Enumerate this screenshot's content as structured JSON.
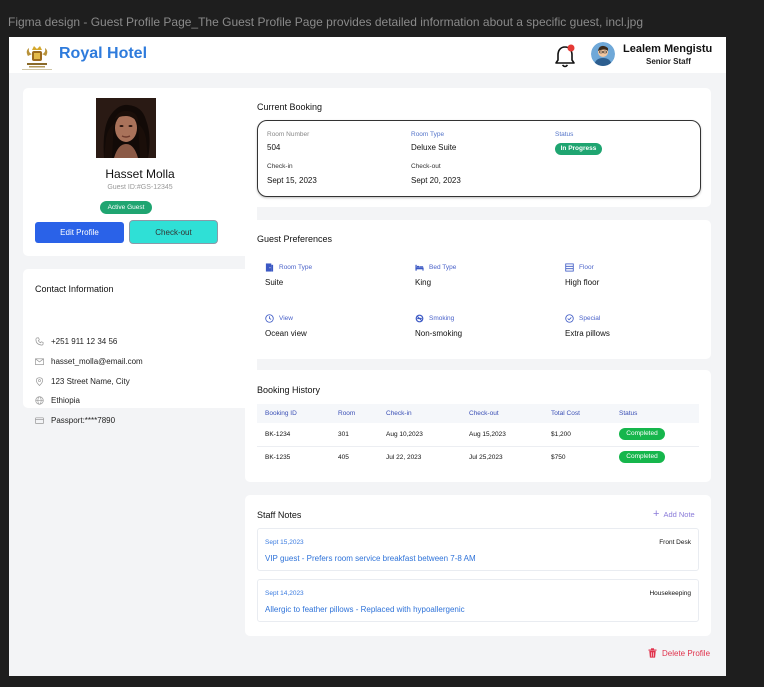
{
  "window_title": "Figma design - Guest Profile Page_The Guest Profile Page provides detailed information about a specific guest, incl.jpg",
  "header": {
    "brand": "Royal Hotel",
    "user_name": "Lealem Mengistu",
    "user_role": "Senior Staff"
  },
  "profile": {
    "name": "Hasset Molla",
    "guest_id": "Guest ID:#GS-12345",
    "status_badge": "Active Guest",
    "edit_label": "Edit Profile",
    "checkout_label": "Check-out"
  },
  "contact": {
    "title": "Contact Information",
    "phone": "+251 911 12 34 56",
    "email": "hasset_molla@email.com",
    "address": "123 Street Name, City",
    "country": "Ethiopia",
    "passport": "Passport:****7890"
  },
  "current_booking": {
    "title": "Current Booking",
    "room_number_label": "Room Number",
    "room_number": "504",
    "room_type_label": "Room Type",
    "room_type": "Deluxe Suite",
    "status_label": "Status",
    "status": "In Progress",
    "checkin_label": "Check-in",
    "checkin": "Sept 15, 2023",
    "checkout_label": "Check-out",
    "checkout": "Sept 20, 2023"
  },
  "preferences": {
    "title": "Guest Preferences",
    "items": [
      {
        "label": "Room Type",
        "value": "Suite",
        "icon": "door-icon"
      },
      {
        "label": "Bed Type",
        "value": "King",
        "icon": "bed-icon"
      },
      {
        "label": "Floor",
        "value": "High floor",
        "icon": "floor-icon"
      },
      {
        "label": "View",
        "value": "Ocean view",
        "icon": "clock-icon"
      },
      {
        "label": "Smoking",
        "value": "Non-smoking",
        "icon": "no-smoking-icon"
      },
      {
        "label": "Special",
        "value": "Extra pillows",
        "icon": "check-circle-icon"
      }
    ]
  },
  "history": {
    "title": "Booking History",
    "columns": [
      "Booking ID",
      "Room",
      "Check-in",
      "Check-out",
      "Total Cost",
      "Status"
    ],
    "rows": [
      {
        "id": "BK-1234",
        "room": "301",
        "checkin": "Aug 10,2023",
        "checkout": "Aug 15,2023",
        "cost": "$1,200",
        "status": "Completed"
      },
      {
        "id": "BK-1235",
        "room": "405",
        "checkin": "Jul 22, 2023",
        "checkout": "Jul 25,2023",
        "cost": "$750",
        "status": "Completed"
      }
    ]
  },
  "notes": {
    "title": "Staff Notes",
    "add_label": "Add Note",
    "items": [
      {
        "date": "Sept 15,2023",
        "dept": "Front Desk",
        "text": "VIP guest - Prefers room service breakfast between 7-8 AM"
      },
      {
        "date": "Sept 14,2023",
        "dept": "Housekeeping",
        "text": "Allergic to feather pillows - Replaced with hypoallergenic"
      }
    ]
  },
  "delete_label": "Delete Profile",
  "colors": {
    "brand": "#2e7bdc",
    "primary_button": "#2a62e8",
    "checkout_button": "#2fe0d6",
    "success": "#1fa571",
    "danger": "#e0334d"
  }
}
